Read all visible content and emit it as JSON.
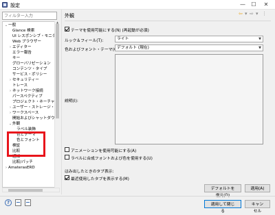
{
  "window": {
    "title": "設定",
    "minimize": "—",
    "maximize": "☐",
    "close": "✕"
  },
  "filter": {
    "placeholder": "フィルター入力"
  },
  "tree": [
    {
      "label": "一般",
      "expanded": true,
      "depth": 0,
      "twisty": "v"
    },
    {
      "label": "Glance 検索",
      "depth": 1
    },
    {
      "label": "UI レスポンシブ・モニター",
      "depth": 1
    },
    {
      "label": "Web ブラウザー",
      "depth": 1
    },
    {
      "label": "エディター",
      "depth": 1,
      "twisty": ">"
    },
    {
      "label": "エラー報告",
      "depth": 1
    },
    {
      "label": "キー",
      "depth": 1
    },
    {
      "label": "グローバリゼーション",
      "depth": 1
    },
    {
      "label": "コンテンツ・タイプ",
      "depth": 1
    },
    {
      "label": "サービス・ポリシー",
      "depth": 1
    },
    {
      "label": "セキュリティー",
      "depth": 1,
      "twisty": ">"
    },
    {
      "label": "トレース",
      "depth": 1
    },
    {
      "label": "ネットワーク接続",
      "depth": 1,
      "twisty": ">"
    },
    {
      "label": "パースペクティブ",
      "depth": 1
    },
    {
      "label": "プロジェクト・ネーチャー",
      "depth": 1
    },
    {
      "label": "ユーザー・ストレージ・サー",
      "depth": 1,
      "twisty": ">"
    },
    {
      "label": "ワークスペース",
      "depth": 1,
      "twisty": ">"
    },
    {
      "label": "開始およびシャットダウン",
      "depth": 1
    },
    {
      "label": "外観",
      "depth": 1,
      "twisty": "v"
    },
    {
      "label": "ラベル装飾",
      "depth": 2
    },
    {
      "label": "色とテーマ",
      "depth": 2
    },
    {
      "label": "色とフォント",
      "depth": 2
    },
    {
      "label": "検証",
      "depth": 1
    },
    {
      "label": "比較",
      "depth": 1
    },
    {
      "label": "通知",
      "depth": 1
    },
    {
      "label": "比較/パッチ",
      "depth": 1
    },
    {
      "label": "AmaterasERD",
      "depth": 0,
      "twisty": ">"
    }
  ],
  "page": {
    "title": "外観",
    "nav_back": "⇦",
    "nav_back_menu": "▾",
    "nav_fwd": "⇨",
    "nav_fwd_menu": "▾",
    "nav_menu": "⋮",
    "theme_enable_label": "テーマを使用可能にする(N) (再起動が必須)",
    "theme_enable_checked": true,
    "look_feel_label": "ルック＆フィール(T):",
    "look_feel_value": "ライト",
    "color_font_theme_label": "色およびフォント・テーマ(C):",
    "color_font_theme_value": "デフォルト (現在)",
    "description_label": "説明(I):",
    "animations_label": "アニメーションを使用可能にする(A)",
    "animations_checked": false,
    "label_color_label": "ラベルに合成フォントおよび色を使用する(U)",
    "label_color_checked": false,
    "tabs_group_label": "はみ出したときのタブ表示:",
    "recent_tabs_label": "最近使用したタブを表示する(M)",
    "recent_tabs_checked": true,
    "restore_defaults": "デフォルトを復元(D)",
    "apply": "適用(A)"
  },
  "footer": {
    "help_icon": "?",
    "apply_close": "適用して閉じる",
    "cancel": "キャンセル"
  },
  "colors": {
    "highlight_box": "#e8141b",
    "primary_border": "#0078d7"
  }
}
